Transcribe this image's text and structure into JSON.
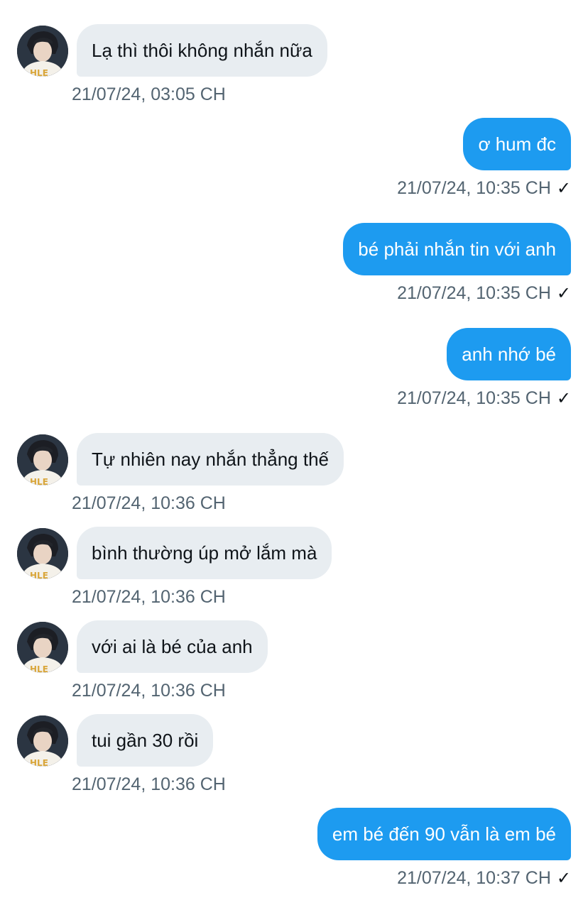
{
  "messages": [
    {
      "side": "in",
      "text": "Lạ thì thôi không nhắn nữa",
      "time": "21/07/24, 03:05 CH"
    },
    {
      "side": "out",
      "text": "ơ hum đc",
      "time": "21/07/24, 10:35 CH",
      "read": "✓"
    },
    {
      "side": "out",
      "text": "bé phải nhắn tin với anh",
      "time": "21/07/24, 10:35 CH",
      "read": "✓"
    },
    {
      "side": "out",
      "text": "anh nhớ bé",
      "time": "21/07/24, 10:35 CH",
      "read": "✓"
    },
    {
      "side": "in",
      "text": "Tự nhiên nay nhắn thẳng thế",
      "time": "21/07/24, 10:36 CH"
    },
    {
      "side": "in",
      "text": "bình thường úp mở lắm mà",
      "time": "21/07/24, 10:36 CH"
    },
    {
      "side": "in",
      "text": "với ai là bé của anh",
      "time": "21/07/24, 10:36 CH"
    },
    {
      "side": "in",
      "text": "tui gần 30 rồi",
      "time": "21/07/24, 10:36 CH"
    },
    {
      "side": "out",
      "text": "em bé đến 90 vẫn là em bé",
      "time": "21/07/24, 10:37 CH",
      "read": "✓"
    }
  ],
  "colors": {
    "incoming_bubble": "#e8edf1",
    "outgoing_bubble": "#1d9bf0",
    "timestamp": "#536471"
  },
  "icons": {
    "read_receipt": "check-icon",
    "avatar": "profile-avatar"
  }
}
